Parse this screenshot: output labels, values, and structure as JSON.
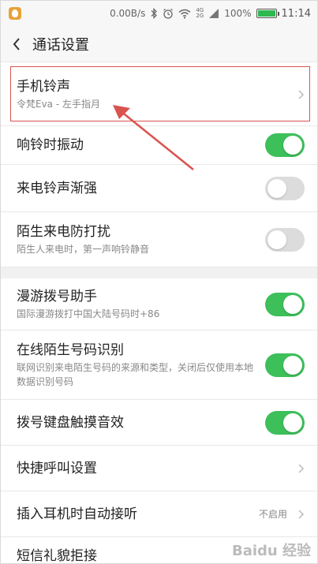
{
  "status_bar": {
    "speed": "0.00B/s",
    "net_4g_top": "4G",
    "net_4g_bottom": "2G",
    "battery_percent": "100%",
    "time": "11:14",
    "icons": [
      "app-icon",
      "bluetooth-icon",
      "alarm-icon",
      "wifi-icon",
      "signal-icon",
      "battery-icon"
    ]
  },
  "header": {
    "title": "通话设置"
  },
  "settings": {
    "ringtone": {
      "label": "手机铃声",
      "sub": "令梵Eva - 左手指月"
    },
    "vibrate": {
      "label": "响铃时振动",
      "on": true
    },
    "crescendo": {
      "label": "来电铃声渐强",
      "on": false
    },
    "stranger_dnd": {
      "label": "陌生来电防打扰",
      "sub": "陌生人来电时，第一声响铃静音",
      "on": false
    },
    "roaming": {
      "label": "漫游拨号助手",
      "sub": "国际漫游拨打中国大陆号码时+86",
      "on": true
    },
    "online_id": {
      "label": "在线陌生号码识别",
      "sub": "联网识别来电陌生号码的来源和类型，关闭后仅使用本地数据识别号码",
      "on": true
    },
    "dialpad_sound": {
      "label": "拨号键盘触摸音效",
      "on": true
    },
    "quick_call": {
      "label": "快捷呼叫设置"
    },
    "auto_answer": {
      "label": "插入耳机时自动接听",
      "value": "不启用"
    },
    "sms_reject": {
      "label": "短信礼貌拒接"
    }
  },
  "annotation": {
    "color": "#d9534f"
  },
  "watermark": "Baidu 经验",
  "colors": {
    "toggle_on": "#3dbf5a",
    "toggle_off": "#dcdcdc",
    "highlight": "#d9534f"
  }
}
